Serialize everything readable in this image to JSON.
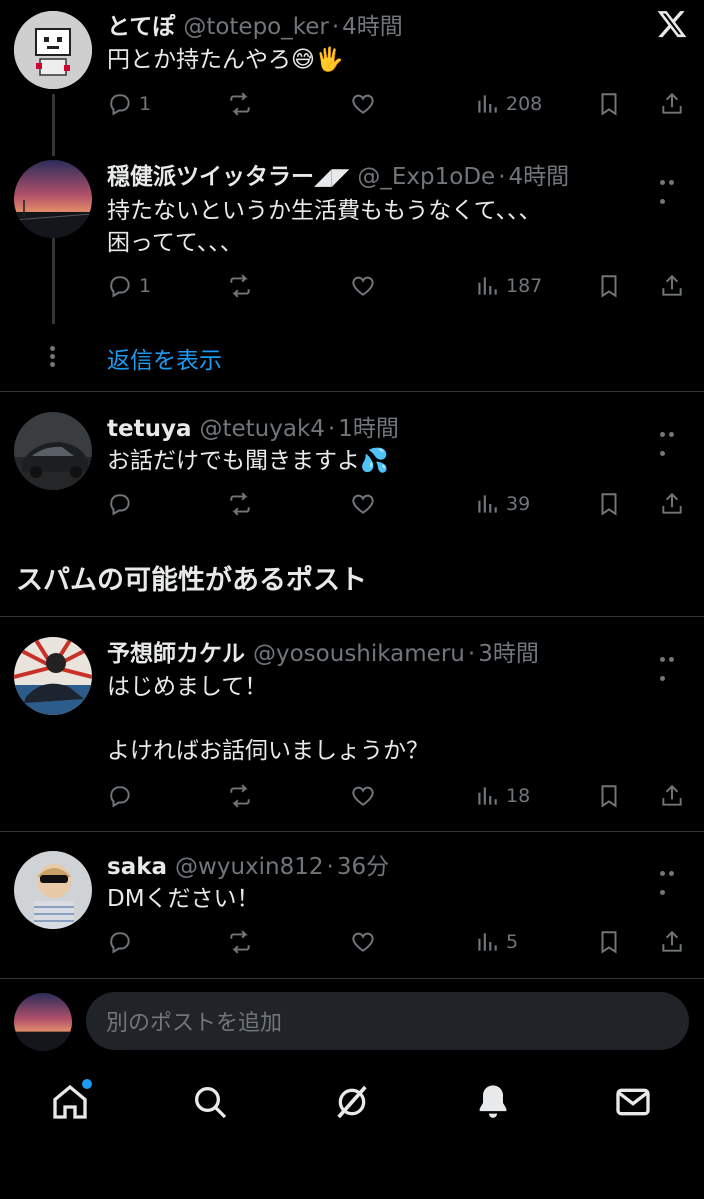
{
  "colors": {
    "background": "#000000",
    "text": "#e7e9ea",
    "muted": "#71767b",
    "accent": "#1d9bf0",
    "divider": "#2f3336"
  },
  "header": {
    "logo_icon": "x-logo-icon"
  },
  "posts": [
    {
      "name": "とてぽ",
      "handle": "@totepo_ker",
      "time": "4時間",
      "text": "円とか持たんやろ😅🖐️",
      "replies": "1",
      "reposts": "",
      "likes": "",
      "views": "208"
    },
    {
      "name": "穏健派ツイッタラー◢◤",
      "handle": "@_Exp1oDe",
      "time": "4時間",
      "text": "持たないというか生活費ももうなくて、、、\n困ってて、、、",
      "replies": "1",
      "reposts": "",
      "likes": "",
      "views": "187"
    },
    {
      "name": "tetuya",
      "handle": "@tetuyak4",
      "time": "1時間",
      "text": "お話だけでも聞きますよ💦",
      "replies": "",
      "reposts": "",
      "likes": "",
      "views": "39"
    },
    {
      "name": "予想師カケル",
      "handle": "@yosoushikameru",
      "time": "3時間",
      "text": "はじめまして！\n\nよければお話伺いましょうか？",
      "replies": "",
      "reposts": "",
      "likes": "",
      "views": "18"
    },
    {
      "name": "saka",
      "handle": "@wyuxin812",
      "time": "36分",
      "text": "DMください！",
      "replies": "",
      "reposts": "",
      "likes": "",
      "views": "5"
    }
  ],
  "thread": {
    "show_replies": "返信を表示"
  },
  "section": {
    "title": "スパムの可能性があるポスト"
  },
  "separator": "·",
  "reply_bar": {
    "placeholder": "別のポストを追加"
  },
  "tabbar": {
    "items": [
      "home-icon",
      "search-icon",
      "grok-icon",
      "notifications-icon",
      "messages-icon"
    ],
    "home_has_badge": true
  }
}
